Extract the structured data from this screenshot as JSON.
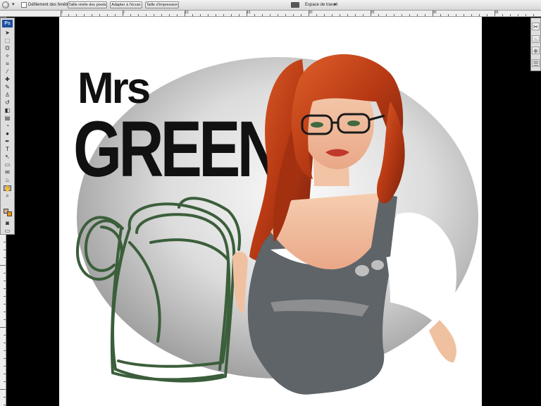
{
  "options_bar": {
    "scroll_all_windows": "Défilement des fenêtres",
    "buttons": [
      {
        "name": "actual-pixels-button",
        "label": "Taille réelle des pixels"
      },
      {
        "name": "fit-screen-button",
        "label": "Adapter à l'écran"
      },
      {
        "name": "print-size-button",
        "label": "Taille d'impression"
      }
    ],
    "workspace_label": "Espace de travail"
  },
  "ruler": {
    "numbers": [
      "0",
      "5",
      "10",
      "15",
      "20",
      "25",
      "30",
      "35"
    ]
  },
  "toolbox": {
    "app_logo": "Ps",
    "tools": [
      {
        "name": "move-tool-icon",
        "glyph": "➤"
      },
      {
        "name": "marquee-tool-icon",
        "glyph": "⬚"
      },
      {
        "name": "lasso-tool-icon",
        "glyph": "ʘ"
      },
      {
        "name": "magic-wand-icon",
        "glyph": "✧"
      },
      {
        "name": "crop-tool-icon",
        "glyph": "⌗"
      },
      {
        "name": "eyedropper-icon",
        "glyph": "⁄"
      },
      {
        "name": "healing-brush-icon",
        "glyph": "✚"
      },
      {
        "name": "brush-tool-icon",
        "glyph": "✎"
      },
      {
        "name": "clone-stamp-icon",
        "glyph": "♙"
      },
      {
        "name": "history-brush-icon",
        "glyph": "↺"
      },
      {
        "name": "eraser-icon",
        "glyph": "◧"
      },
      {
        "name": "gradient-tool-icon",
        "glyph": "▤"
      },
      {
        "name": "blur-tool-icon",
        "glyph": "◔"
      },
      {
        "name": "dodge-tool-icon",
        "glyph": "●"
      },
      {
        "name": "pen-tool-icon",
        "glyph": "✒"
      },
      {
        "name": "type-tool-icon",
        "glyph": "T"
      },
      {
        "name": "path-selection-icon",
        "glyph": "↖"
      },
      {
        "name": "shape-tool-icon",
        "glyph": "▭"
      },
      {
        "name": "notes-tool-icon",
        "glyph": "✉"
      },
      {
        "name": "eyedropper-3d-icon",
        "glyph": "♨"
      },
      {
        "name": "hand-tool-icon",
        "glyph": "✋"
      },
      {
        "name": "zoom-tool-icon",
        "glyph": "⌕"
      }
    ],
    "selected_tool": "hand-tool-icon"
  },
  "colors": {
    "foreground": "#d9a88e",
    "background": "#f29400",
    "canvas_bg": "#ffffff",
    "ellipse_light": "#f4f4f4",
    "ellipse_dark": "#9f9f9f",
    "hair": "#b83a14",
    "overall": "#5f6469",
    "sketch_green": "#3b5e3b",
    "title_text": "#111111"
  },
  "canvas": {
    "title_small": "Mrs",
    "title_large": "GREEN"
  },
  "right_panel": {
    "icons": [
      "tools-icon",
      "brush-presets-icon",
      "clone-source-icon",
      "layers-icon"
    ]
  }
}
